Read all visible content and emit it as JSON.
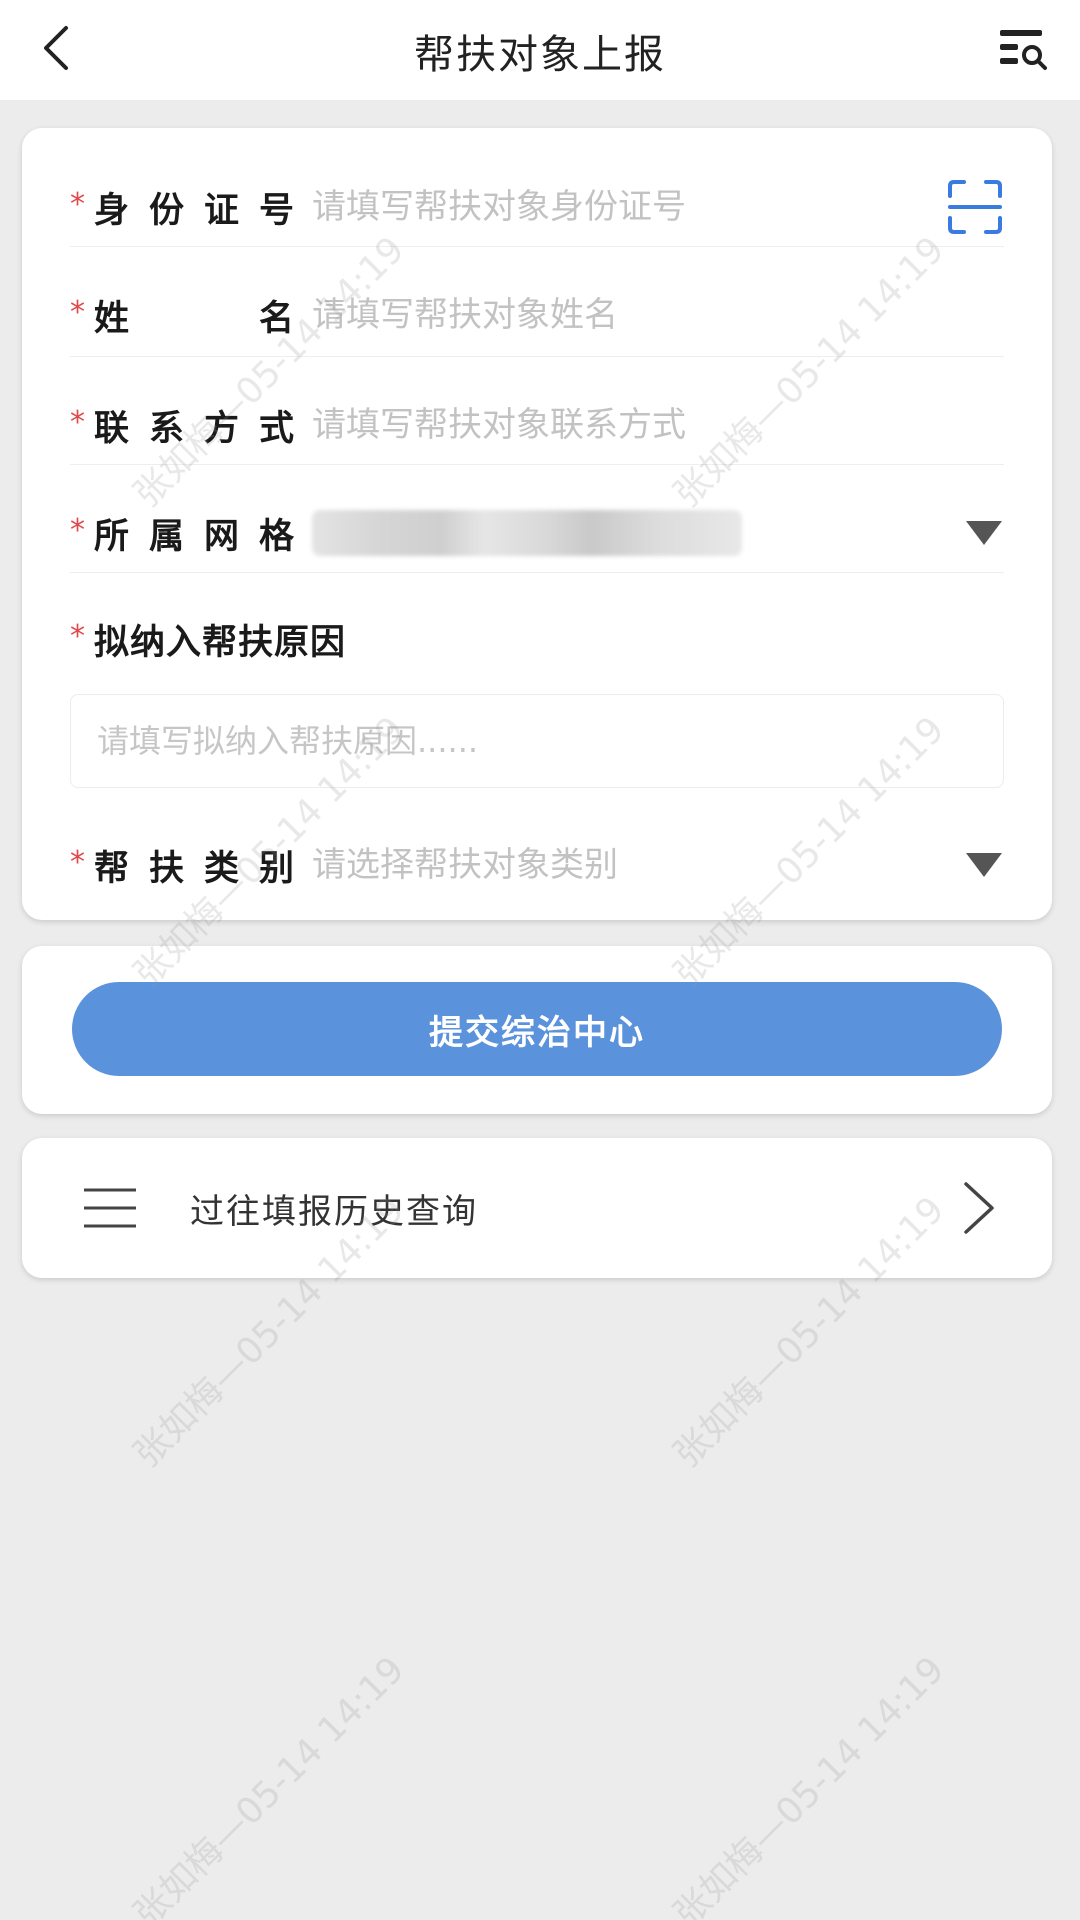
{
  "header": {
    "title": "帮扶对象上报",
    "back_icon": "back-chevron-icon",
    "history_icon": "list-search-icon"
  },
  "form": {
    "required_mark": "*",
    "id_number": {
      "label_chars": [
        "身",
        "份",
        "证",
        "号"
      ],
      "placeholder": "请填写帮扶对象身份证号",
      "scan_icon": "scan-icon"
    },
    "name": {
      "label_chars": [
        "姓",
        "名"
      ],
      "placeholder": "请填写帮扶对象姓名"
    },
    "contact": {
      "label_chars": [
        "联",
        "系",
        "方",
        "式"
      ],
      "placeholder": "请填写帮扶对象联系方式"
    },
    "grid": {
      "label_chars": [
        "所",
        "属",
        "网",
        "格"
      ],
      "dropdown_icon": "triangle-down-icon"
    },
    "reason": {
      "label": "拟纳入帮扶原因",
      "placeholder": "请填写拟纳入帮扶原因......"
    },
    "category": {
      "label_chars": [
        "帮",
        "扶",
        "类",
        "别"
      ],
      "placeholder": "请选择帮扶对象类别",
      "dropdown_icon": "triangle-down-icon"
    }
  },
  "submit": {
    "label": "提交综治中心"
  },
  "history": {
    "label": "过往填报历史查询",
    "menu_icon": "menu-icon",
    "chevron_icon": "chevron-right-icon"
  },
  "watermark": {
    "text": "张如梅—05-14 14:19"
  },
  "colors": {
    "accent": "#5b92dc",
    "scan_icon": "#3a7be0",
    "required": "#e0484a",
    "background": "#ececec"
  }
}
